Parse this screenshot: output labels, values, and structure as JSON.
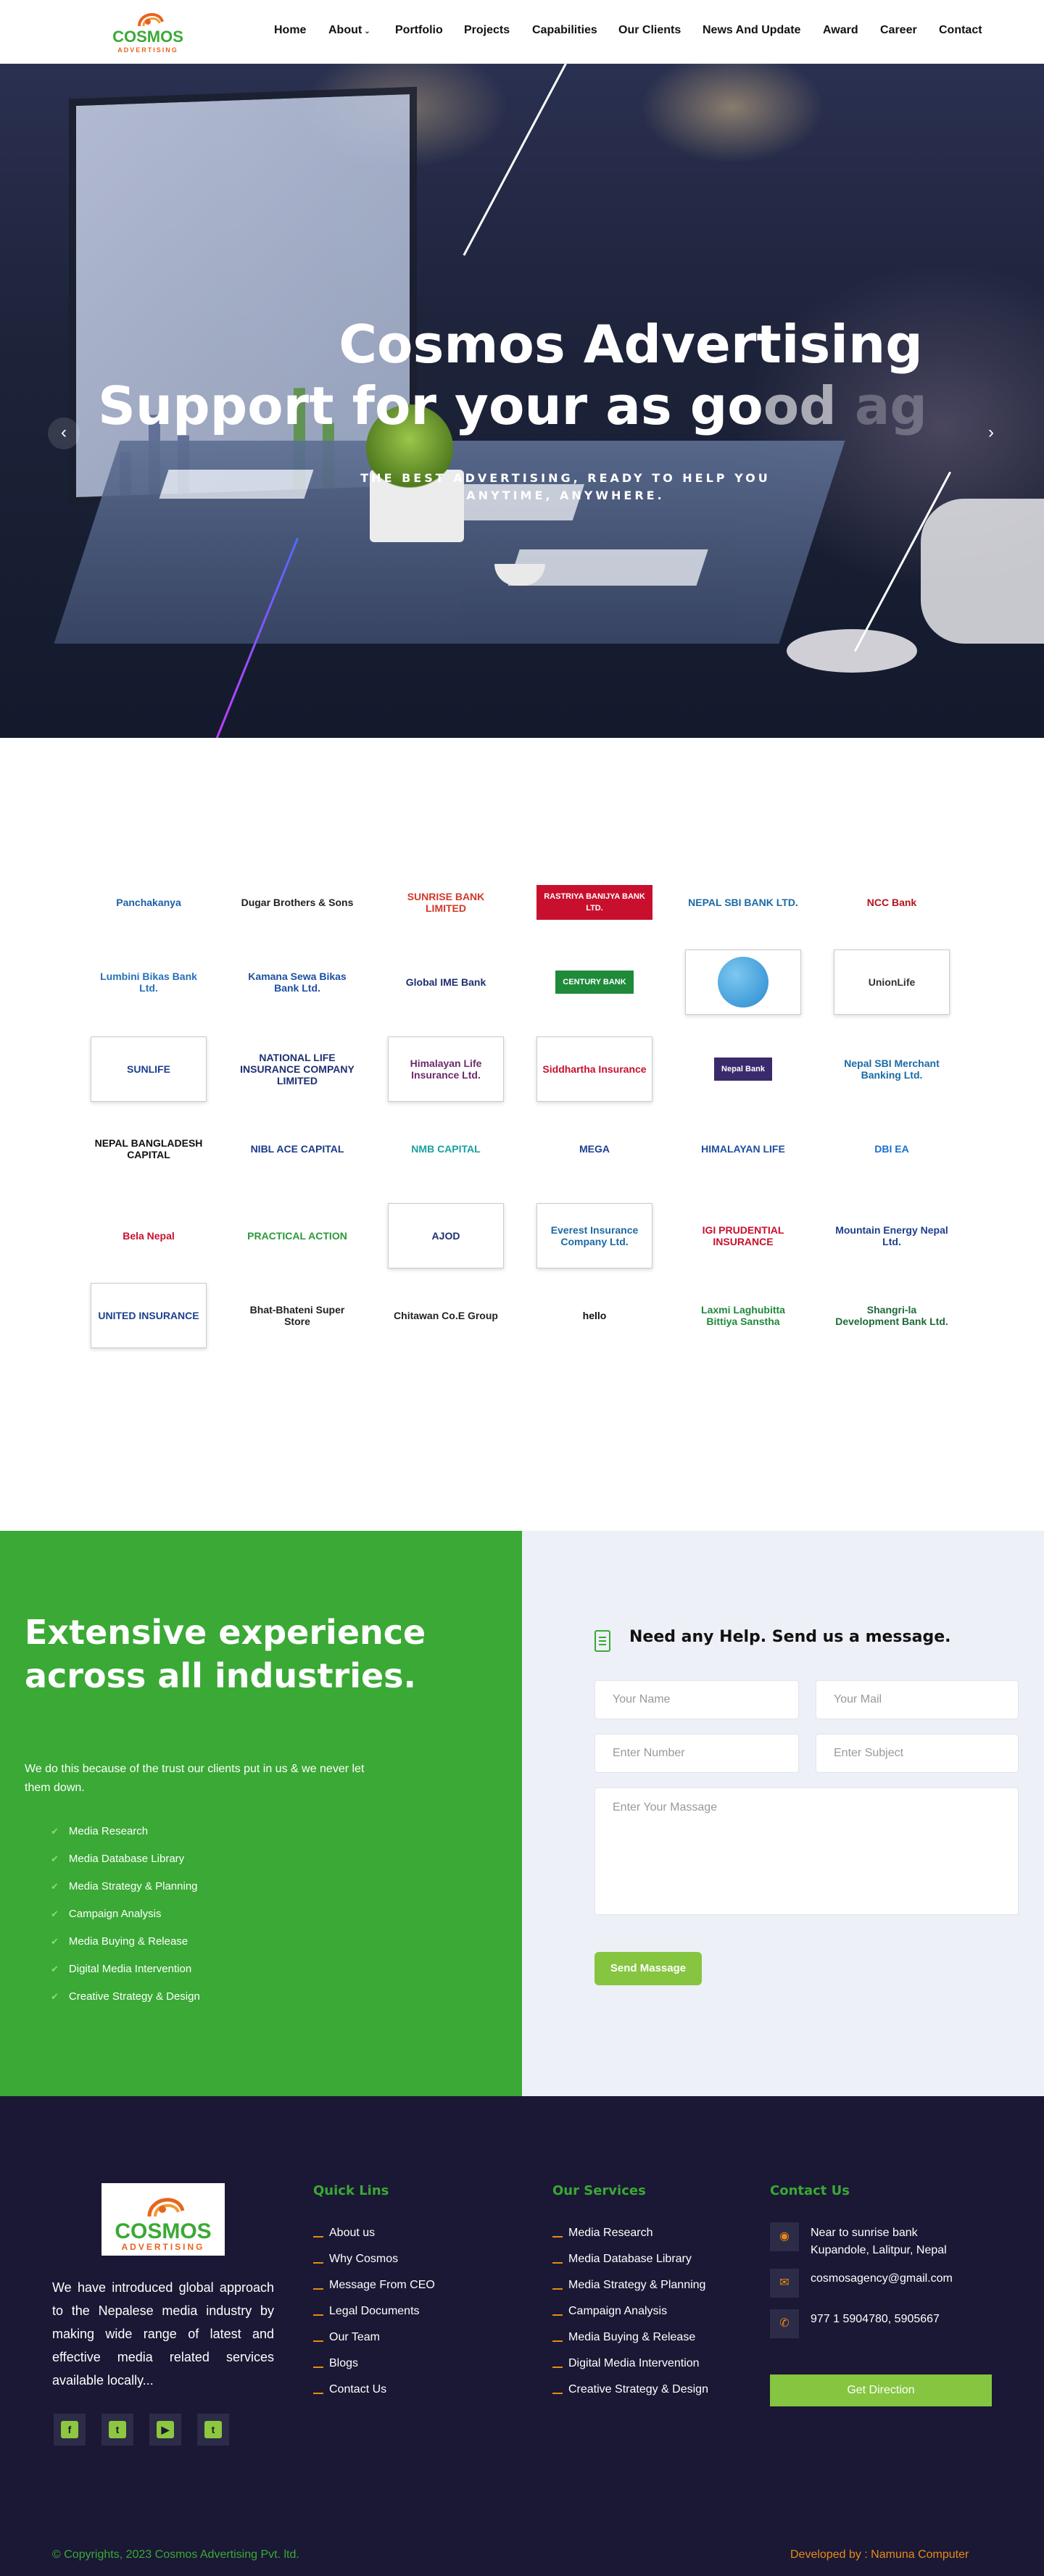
{
  "header": {
    "logo_name": "COSMOS",
    "logo_sub": "ADVERTISING",
    "nav": [
      "Home",
      "About",
      "Portfolio",
      "Projects",
      "Capabilities",
      "Our Clients",
      "News And Update",
      "Award",
      "Career",
      "Contact"
    ]
  },
  "hero": {
    "title_line1": "Cosmos Advertising",
    "title_line2a": "Support for your as go",
    "title_line2b": "o",
    "title_line2c": "d",
    "title_line2d": " ag",
    "subtitle_line1": "THE BEST ADVERTISING, READY TO HELP YOU",
    "subtitle_line2": "ANYTIME, ANYWHERE."
  },
  "clients": [
    {
      "text": "Panchakanya",
      "color": "#1c5fa8",
      "style": "plain"
    },
    {
      "text": "Dugar Brothers & Sons",
      "color": "#222222",
      "style": "plain"
    },
    {
      "text": "SUNRISE BANK LIMITED",
      "color": "#d03a2a",
      "style": "plain"
    },
    {
      "text": "RASTRIYA BANIJYA BANK LTD.",
      "color": "#ffffff",
      "style": "band",
      "bg": "#c8102e"
    },
    {
      "text": "NEPAL SBI BANK LTD.",
      "color": "#1b6aa5",
      "style": "plain"
    },
    {
      "text": "NCC Bank",
      "color": "#b5121b",
      "style": "plain"
    },
    {
      "text": "Lumbini Bikas Bank Ltd.",
      "color": "#2470b8",
      "style": "plain"
    },
    {
      "text": "Kamana Sewa Bikas Bank Ltd.",
      "color": "#1e4fa0",
      "style": "plain"
    },
    {
      "text": "Global IME Bank",
      "color": "#1d2f6f",
      "style": "plain"
    },
    {
      "text": "CENTURY BANK",
      "color": "#ffffff",
      "style": "band",
      "bg": "#1e8a3a"
    },
    {
      "text": "",
      "color": "#2a8ad0",
      "style": "globe"
    },
    {
      "text": "UnionLife",
      "color": "#333333",
      "style": "box"
    },
    {
      "text": "SUNLIFE",
      "color": "#1d3f8f",
      "style": "box"
    },
    {
      "text": "NATIONAL LIFE INSURANCE COMPANY LIMITED",
      "color": "#1d2f6f",
      "style": "plain"
    },
    {
      "text": "Himalayan Life Insurance Ltd.",
      "color": "#6b2b6b",
      "style": "box"
    },
    {
      "text": "Siddhartha Insurance",
      "color": "#c8102e",
      "style": "box"
    },
    {
      "text": "Nepal Bank",
      "color": "#ffffff",
      "style": "band",
      "bg": "#3b2a6b"
    },
    {
      "text": "Nepal SBI Merchant Banking Ltd.",
      "color": "#1b6aa5",
      "style": "plain"
    },
    {
      "text": "NEPAL BANGLADESH CAPITAL",
      "color": "#111111",
      "style": "plain"
    },
    {
      "text": "NIBL ACE CAPITAL",
      "color": "#1a3a8a",
      "style": "plain"
    },
    {
      "text": "NMB CAPITAL",
      "color": "#1aa0a0",
      "style": "plain"
    },
    {
      "text": "MEGA",
      "color": "#1d3f8f",
      "style": "plain"
    },
    {
      "text": "HIMALAYAN LIFE",
      "color": "#1d4f9f",
      "style": "plain"
    },
    {
      "text": "DBI EA",
      "color": "#1a6fd0",
      "style": "plain"
    },
    {
      "text": "Bela Nepal",
      "color": "#c8102e",
      "style": "plain"
    },
    {
      "text": "PRACTICAL ACTION",
      "color": "#2a9a3a",
      "style": "plain"
    },
    {
      "text": "AJOD",
      "color": "#1d2f6f",
      "style": "box"
    },
    {
      "text": "Everest Insurance Company Ltd.",
      "color": "#1b6aa5",
      "style": "box"
    },
    {
      "text": "IGI PRUDENTIAL INSURANCE",
      "color": "#c8102e",
      "style": "plain"
    },
    {
      "text": "Mountain Energy Nepal Ltd.",
      "color": "#1d3f8f",
      "style": "plain"
    },
    {
      "text": "UNITED INSURANCE",
      "color": "#1d3f8f",
      "style": "box"
    },
    {
      "text": "Bhat-Bhateni Super Store",
      "color": "#222222",
      "style": "plain"
    },
    {
      "text": "Chitawan Co.E Group",
      "color": "#222222",
      "style": "plain"
    },
    {
      "text": "hello",
      "color": "#111111",
      "style": "plain"
    },
    {
      "text": "Laxmi Laghubitta Bittiya Sanstha",
      "color": "#1e8a3a",
      "style": "plain"
    },
    {
      "text": "Shangri-la Development Bank Ltd.",
      "color": "#1e6a3a",
      "style": "plain"
    }
  ],
  "experience": {
    "title": "Extensive experience across all industries.",
    "desc": "We do this because of the trust our clients put in us & we never let them down.",
    "services": [
      "Media Research",
      "Media Database Library",
      "Media Strategy & Planning",
      "Campaign Analysis",
      "Media Buying & Release",
      "Digital Media Intervention",
      "Creative Strategy & Design"
    ]
  },
  "form": {
    "title": "Need any Help. Send us a message.",
    "name_ph": "Your Name",
    "mail_ph": "Your Mail",
    "number_ph": "Enter Number",
    "subject_ph": "Enter Subject",
    "message_ph": "Enter Your Massage",
    "send": "Send Massage"
  },
  "footer": {
    "about": "We have introduced global approach to the Nepalese media industry by making wide range of latest and effective media related services available locally...",
    "quick_title": "Quick Lins",
    "quick_links": [
      "About us",
      "Why Cosmos",
      "Message From CEO",
      "Legal Documents",
      "Our Team",
      "Blogs",
      "Contact Us"
    ],
    "services_title": "Our Services",
    "services": [
      "Media Research",
      "Media Database Library",
      "Media Strategy & Planning",
      "Campaign Analysis",
      "Media Buying & Release",
      "Digital Media Intervention",
      "Creative Strategy & Design"
    ],
    "contact_title": "Contact Us",
    "address_line1": "Near to sunrise bank",
    "address_line2": "Kupandole, Lalitpur, Nepal",
    "email": "cosmosagency@gmail.com",
    "phone": "977 1 5904780, 5905667",
    "direction": "Get Direction",
    "copyright": "© Copyrights, 2023 Cosmos Advertising Pvt. ltd.",
    "developer": "Developed by : Namuna Computer"
  },
  "colors": {
    "green": "#3aa935",
    "light_green": "#85c540",
    "orange": "#e88a14",
    "footer_bg": "#1a1834",
    "form_bg": "#edf0f7"
  }
}
